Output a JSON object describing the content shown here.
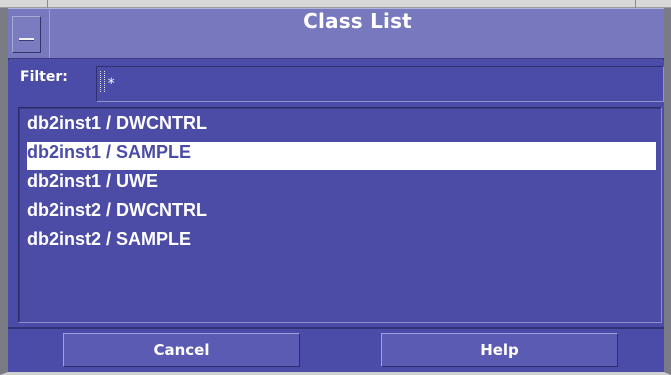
{
  "window": {
    "title": "Class List"
  },
  "filter": {
    "label": "Filter:",
    "value": "*"
  },
  "list": {
    "items": [
      {
        "label": "db2inst1 / DWCNTRL",
        "selected": false
      },
      {
        "label": "db2inst1 / SAMPLE",
        "selected": true
      },
      {
        "label": "db2inst1 / UWE",
        "selected": false
      },
      {
        "label": "db2inst2 / DWCNTRL",
        "selected": false
      },
      {
        "label": "db2inst2 / SAMPLE",
        "selected": false
      }
    ]
  },
  "buttons": {
    "cancel_label": "Cancel",
    "help_label": "Help"
  },
  "colors": {
    "panel": "#4b4ba8",
    "title": "#7878bf",
    "selection": "#ffffff"
  },
  "icons": {
    "menu": "window-menu-icon"
  }
}
